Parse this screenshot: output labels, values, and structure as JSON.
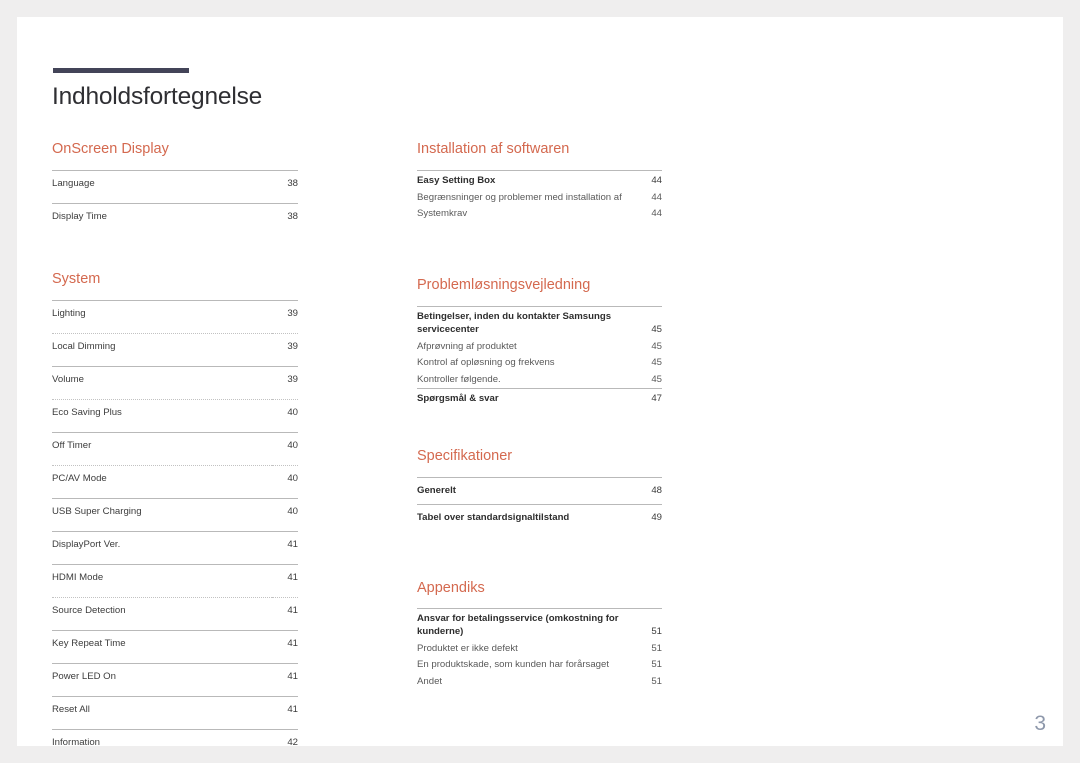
{
  "document": {
    "title": "Indholdsfortegnelse",
    "page_number": "3",
    "accent_color": "#d4694f",
    "rule_color": "#434458",
    "folio_color": "#8e98ab"
  },
  "left_column": {
    "sections": [
      {
        "heading": "OnScreen Display",
        "style": "spaced",
        "entries": [
          {
            "label": "Language",
            "page": "38",
            "sep": "solid"
          },
          {
            "label": "Display Time",
            "page": "38",
            "sep": "solid"
          }
        ]
      },
      {
        "heading": "System",
        "style": "spaced",
        "entries": [
          {
            "label": "Lighting",
            "page": "39",
            "sep": "solid"
          },
          {
            "label": "Local Dimming",
            "page": "39",
            "sep": "dotted"
          },
          {
            "label": "Volume",
            "page": "39",
            "sep": "solid"
          },
          {
            "label": "Eco Saving Plus",
            "page": "40",
            "sep": "dotted"
          },
          {
            "label": "Off Timer",
            "page": "40",
            "sep": "solid"
          },
          {
            "label": "PC/AV Mode",
            "page": "40",
            "sep": "dotted"
          },
          {
            "label": "USB Super Charging",
            "page": "40",
            "sep": "solid"
          },
          {
            "label": "DisplayPort Ver.",
            "page": "41",
            "sep": "solid"
          },
          {
            "label": "HDMI Mode",
            "page": "41",
            "sep": "solid"
          },
          {
            "label": "Source Detection",
            "page": "41",
            "sep": "dotted"
          },
          {
            "label": "Key Repeat Time",
            "page": "41",
            "sep": "solid"
          },
          {
            "label": "Power LED On",
            "page": "41",
            "sep": "solid"
          },
          {
            "label": "Reset All",
            "page": "41",
            "sep": "solid"
          },
          {
            "label": "Information",
            "page": "42",
            "sep": "solid"
          }
        ]
      }
    ]
  },
  "right_column": {
    "sections": [
      {
        "heading": "Installation af softwaren",
        "style": "compact",
        "entries": [
          {
            "label": "Easy Setting Box",
            "page": "44",
            "sep": "solid",
            "emphasis": "strong"
          },
          {
            "label": "Begrænsninger og problemer med installation af",
            "page": "44",
            "sep": "none",
            "emphasis": "sub"
          },
          {
            "label": "Systemkrav",
            "page": "44",
            "sep": "none",
            "emphasis": "sub"
          }
        ]
      },
      {
        "heading": "Problemløsningsvejledning",
        "style": "compact",
        "entries": [
          {
            "label": "Betingelser, inden du kontakter Samsungs servicecenter",
            "page": "45",
            "sep": "solid",
            "emphasis": "strong"
          },
          {
            "label": "Afprøvning af produktet",
            "page": "45",
            "sep": "none",
            "emphasis": "sub"
          },
          {
            "label": "Kontrol af opløsning og frekvens",
            "page": "45",
            "sep": "none",
            "emphasis": "sub"
          },
          {
            "label": "Kontroller følgende.",
            "page": "45",
            "sep": "none",
            "emphasis": "sub"
          },
          {
            "label": "Spørgsmål & svar",
            "page": "47",
            "sep": "solid",
            "emphasis": "strong"
          }
        ]
      },
      {
        "heading": "Specifikationer",
        "style": "compact-spaced",
        "entries": [
          {
            "label": "Generelt",
            "page": "48",
            "sep": "solid",
            "emphasis": "strong"
          },
          {
            "label": "Tabel over standardsignaltilstand",
            "page": "49",
            "sep": "solid",
            "emphasis": "strong"
          }
        ]
      },
      {
        "heading": "Appendiks",
        "style": "compact",
        "entries": [
          {
            "label": "Ansvar for betalingsservice (omkostning for kunderne)",
            "page": "51",
            "sep": "solid",
            "emphasis": "strong"
          },
          {
            "label": "Produktet er ikke defekt",
            "page": "51",
            "sep": "none",
            "emphasis": "sub"
          },
          {
            "label": "En produktskade, som kunden har forårsaget",
            "page": "51",
            "sep": "none",
            "emphasis": "sub"
          },
          {
            "label": "Andet",
            "page": "51",
            "sep": "none",
            "emphasis": "sub"
          }
        ]
      }
    ]
  }
}
